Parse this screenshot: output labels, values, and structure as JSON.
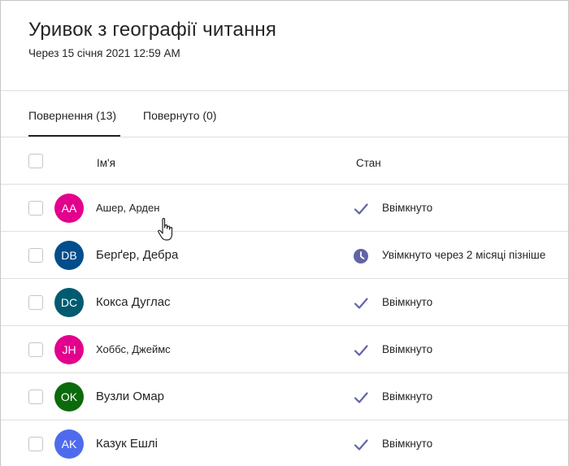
{
  "header": {
    "title": "Уривок з географії читання",
    "due": "Через 15 січня 2021 12:59 AM"
  },
  "tabs": [
    {
      "label": "Повернення (13)",
      "active": true
    },
    {
      "label": "Повернуто (0)",
      "active": false
    }
  ],
  "table": {
    "columns": {
      "name": "Ім'я",
      "status": "Стан"
    },
    "rows": [
      {
        "initials": "AA",
        "name": "Ашер, Арден",
        "status": "Ввімкнуто",
        "status_icon": "check-icon",
        "avatar_color": "#e3008c"
      },
      {
        "initials": "DB",
        "name": "Берґер, Дебра",
        "status": "Увімкнуто через 2 місяці пізніше",
        "status_icon": "clock-icon",
        "avatar_color": "#004e8c"
      },
      {
        "initials": "DC",
        "name": "Кокса Дуглас",
        "status": "Ввімкнуто",
        "status_icon": "check-icon",
        "avatar_color": "#005b70"
      },
      {
        "initials": "JH",
        "name": "Хоббс, Джеймс",
        "status": "Ввімкнуто",
        "status_icon": "check-icon",
        "avatar_color": "#e3008c"
      },
      {
        "initials": "OK",
        "name": "Вузли Омар",
        "status": "Ввімкнуто",
        "status_icon": "check-icon",
        "avatar_color": "#0b6a0b"
      },
      {
        "initials": "AK",
        "name": "Казук Ешлі",
        "status": "Ввімкнуто",
        "status_icon": "check-icon",
        "avatar_color": "#4f6bed"
      }
    ]
  },
  "colors": {
    "accent": "#6264a7",
    "divider": "#e1dfdd"
  }
}
